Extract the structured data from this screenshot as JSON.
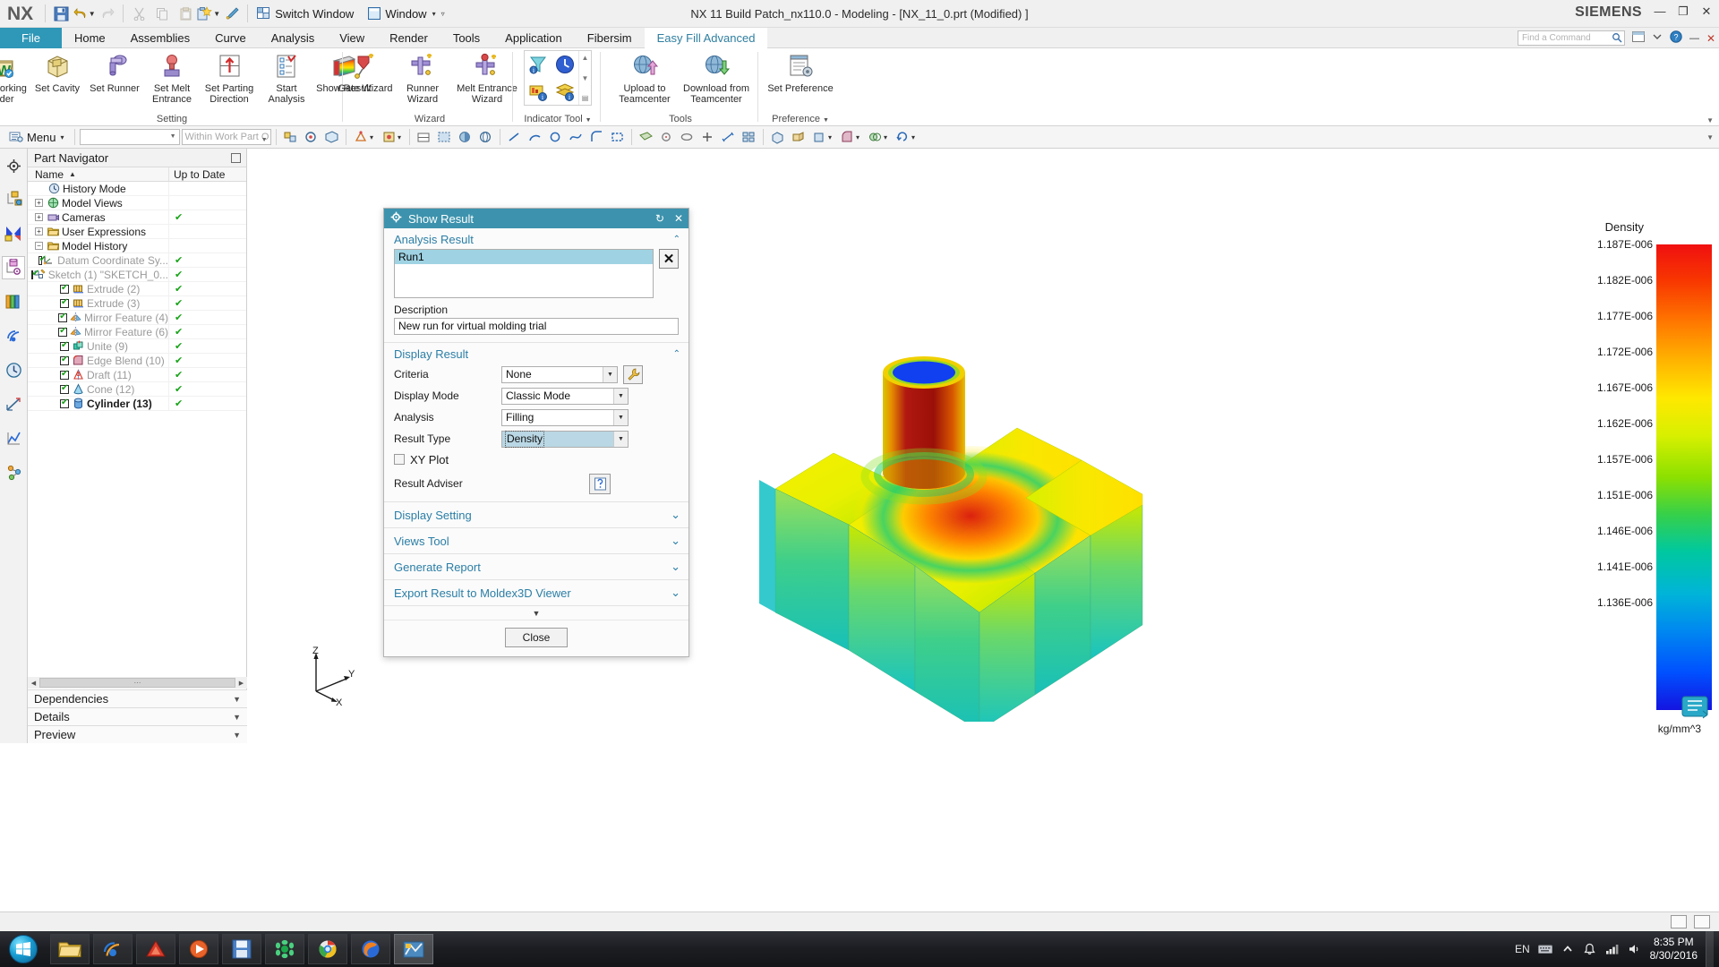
{
  "titlebar": {
    "logo": "NX",
    "switch_window": "Switch Window",
    "window": "Window",
    "document_title": "NX 11  Build Patch_nx110.0 - Modeling - [NX_11_0.prt (Modified) ]",
    "brand": "SIEMENS",
    "window_controls": [
      "—",
      "❐",
      "✕"
    ]
  },
  "tabs": [
    {
      "label": "File",
      "state": "file"
    },
    {
      "label": "Home",
      "state": "normal"
    },
    {
      "label": "Assemblies",
      "state": "normal"
    },
    {
      "label": "Curve",
      "state": "normal"
    },
    {
      "label": "Analysis",
      "state": "normal"
    },
    {
      "label": "View",
      "state": "normal"
    },
    {
      "label": "Render",
      "state": "normal"
    },
    {
      "label": "Tools",
      "state": "normal"
    },
    {
      "label": "Application",
      "state": "normal"
    },
    {
      "label": "Fibersim",
      "state": "normal"
    },
    {
      "label": "Easy Fill Advanced",
      "state": "active"
    }
  ],
  "find_command": {
    "placeholder": "Find a Command"
  },
  "ribbon": {
    "groups": [
      {
        "title": "Setting",
        "buttons": [
          {
            "label": "Set Working Folder",
            "icon": "folder-w-icon"
          },
          {
            "label": "Set Cavity",
            "icon": "cavity-box-icon"
          },
          {
            "label": "Set Runner",
            "icon": "runner-icon"
          },
          {
            "label": "Set Melt Entrance",
            "icon": "melt-entrance-icon"
          },
          {
            "label": "Set Parting Direction",
            "icon": "parting-direction-icon"
          },
          {
            "label": "Start Analysis",
            "icon": "start-analysis-icon"
          },
          {
            "label": "Show Result",
            "icon": "show-result-icon"
          }
        ]
      },
      {
        "title": "Wizard",
        "buttons": [
          {
            "label": "Gate Wizard",
            "icon": "gate-wizard-icon"
          },
          {
            "label": "Runner Wizard",
            "icon": "runner-wizard-icon"
          },
          {
            "label": "Melt Entrance Wizard",
            "icon": "melt-entrance-wizard-icon"
          }
        ]
      },
      {
        "title": "Indicator Tool",
        "gallery": [
          "funnel-info-icon",
          "clock-icon",
          "chart-info-icon",
          "layer-info-icon"
        ]
      },
      {
        "title": "Tools",
        "buttons": [
          {
            "label": "Upload to Teamcenter",
            "icon": "upload-teamcenter-icon"
          },
          {
            "label": "Download from Teamcenter",
            "icon": "download-teamcenter-icon"
          }
        ]
      },
      {
        "title": "Preference",
        "buttons": [
          {
            "label": "Set Preference",
            "icon": "set-preference-icon"
          }
        ]
      }
    ]
  },
  "toolstrip": {
    "menu": "Menu",
    "selection_filter_value": "",
    "scope_value": "Within Work Part O"
  },
  "part_navigator": {
    "title": "Part Navigator",
    "columns": {
      "name": "Name",
      "up_to_date": "Up to Date"
    },
    "items": [
      {
        "label": "History Mode",
        "indent": 1,
        "expander": "",
        "checkbox": false,
        "icon": "clock-icon",
        "ok": "",
        "style": "dark"
      },
      {
        "label": "Model Views",
        "indent": 0,
        "expander": "+",
        "checkbox": false,
        "icon": "model-views-icon",
        "ok": "",
        "style": "dark"
      },
      {
        "label": "Cameras",
        "indent": 0,
        "expander": "+",
        "checkbox": false,
        "icon": "camera-icon",
        "ok": "✔",
        "style": "dark"
      },
      {
        "label": "User Expressions",
        "indent": 0,
        "expander": "+",
        "checkbox": false,
        "icon": "folder-icon",
        "ok": "",
        "style": "dark"
      },
      {
        "label": "Model History",
        "indent": 0,
        "expander": "−",
        "checkbox": false,
        "icon": "folder-icon",
        "ok": "",
        "style": "dark"
      },
      {
        "label": "Datum Coordinate Sy...",
        "indent": 2,
        "expander": "",
        "checkbox": true,
        "icon": "datum-csys-icon",
        "ok": "✔",
        "style": "grey"
      },
      {
        "label": "Sketch (1) \"SKETCH_0...",
        "indent": 2,
        "expander": "",
        "checkbox": true,
        "icon": "sketch-icon",
        "ok": "✔",
        "style": "grey"
      },
      {
        "label": "Extrude (2)",
        "indent": 2,
        "expander": "",
        "checkbox": true,
        "icon": "extrude-icon",
        "ok": "✔",
        "style": "grey"
      },
      {
        "label": "Extrude (3)",
        "indent": 2,
        "expander": "",
        "checkbox": true,
        "icon": "extrude-icon",
        "ok": "✔",
        "style": "grey"
      },
      {
        "label": "Mirror Feature (4)",
        "indent": 2,
        "expander": "",
        "checkbox": true,
        "icon": "mirror-feature-icon",
        "ok": "✔",
        "style": "grey"
      },
      {
        "label": "Mirror Feature (6)",
        "indent": 2,
        "expander": "",
        "checkbox": true,
        "icon": "mirror-feature-icon",
        "ok": "✔",
        "style": "grey"
      },
      {
        "label": "Unite (9)",
        "indent": 2,
        "expander": "",
        "checkbox": true,
        "icon": "unite-icon",
        "ok": "✔",
        "style": "grey"
      },
      {
        "label": "Edge Blend (10)",
        "indent": 2,
        "expander": "",
        "checkbox": true,
        "icon": "edge-blend-icon",
        "ok": "✔",
        "style": "grey"
      },
      {
        "label": "Draft (11)",
        "indent": 2,
        "expander": "",
        "checkbox": true,
        "icon": "draft-icon",
        "ok": "✔",
        "style": "grey"
      },
      {
        "label": "Cone (12)",
        "indent": 2,
        "expander": "",
        "checkbox": true,
        "icon": "cone-icon",
        "ok": "✔",
        "style": "grey"
      },
      {
        "label": "Cylinder (13)",
        "indent": 2,
        "expander": "",
        "checkbox": true,
        "icon": "cylinder-icon",
        "ok": "✔",
        "style": "bold"
      }
    ],
    "sections": [
      {
        "label": "Dependencies"
      },
      {
        "label": "Details"
      },
      {
        "label": "Preview"
      }
    ]
  },
  "dialog": {
    "title": "Show Result",
    "titlebar_icons": [
      "gear-icon",
      "reset-icon",
      "close-icon"
    ],
    "analysis_result": {
      "header": "Analysis Result",
      "runs": [
        "Run1"
      ],
      "selected_run": "Run1",
      "delete_label": "✕",
      "description_label": "Description",
      "description_value": "New run for virtual molding trial"
    },
    "display_result": {
      "header": "Display Result",
      "criteria_label": "Criteria",
      "criteria_value": "None",
      "display_mode_label": "Display Mode",
      "display_mode_value": "Classic Mode",
      "analysis_label": "Analysis",
      "analysis_value": "Filling",
      "result_type_label": "Result Type",
      "result_type_value": "Density",
      "xy_plot_label": "XY Plot",
      "xy_plot_checked": false,
      "result_adviser_label": "Result Adviser"
    },
    "collapsed_sections": [
      {
        "label": "Display Setting"
      },
      {
        "label": "Views Tool"
      },
      {
        "label": "Generate Report"
      },
      {
        "label": "Export Result to Moldex3D Viewer"
      }
    ],
    "close_label": "Close"
  },
  "legend": {
    "title": "Density",
    "unit": "kg/mm^3",
    "ticks": [
      "1.187E-006",
      "1.182E-006",
      "1.177E-006",
      "1.172E-006",
      "1.167E-006",
      "1.162E-006",
      "1.157E-006",
      "1.151E-006",
      "1.146E-006",
      "1.141E-006",
      "1.136E-006"
    ],
    "colors": [
      "#f01010",
      "#ff7a00",
      "#ffe800",
      "#8ce000",
      "#00c8a0",
      "#0088f0",
      "#1414e0"
    ]
  },
  "triad": {
    "x": "X",
    "y": "Y",
    "z": "Z"
  },
  "taskbar": {
    "start_label": "Start",
    "items": [
      {
        "name": "explorer-icon"
      },
      {
        "name": "internet-explorer-icon"
      },
      {
        "name": "pdf-reader-icon"
      },
      {
        "name": "media-player-icon"
      },
      {
        "name": "save-app-icon"
      },
      {
        "name": "green-app-icon"
      },
      {
        "name": "chrome-icon"
      },
      {
        "name": "firefox-icon"
      },
      {
        "name": "nx-app-icon"
      }
    ],
    "language": "EN",
    "time": "8:35 PM",
    "date": "8/30/2016"
  }
}
